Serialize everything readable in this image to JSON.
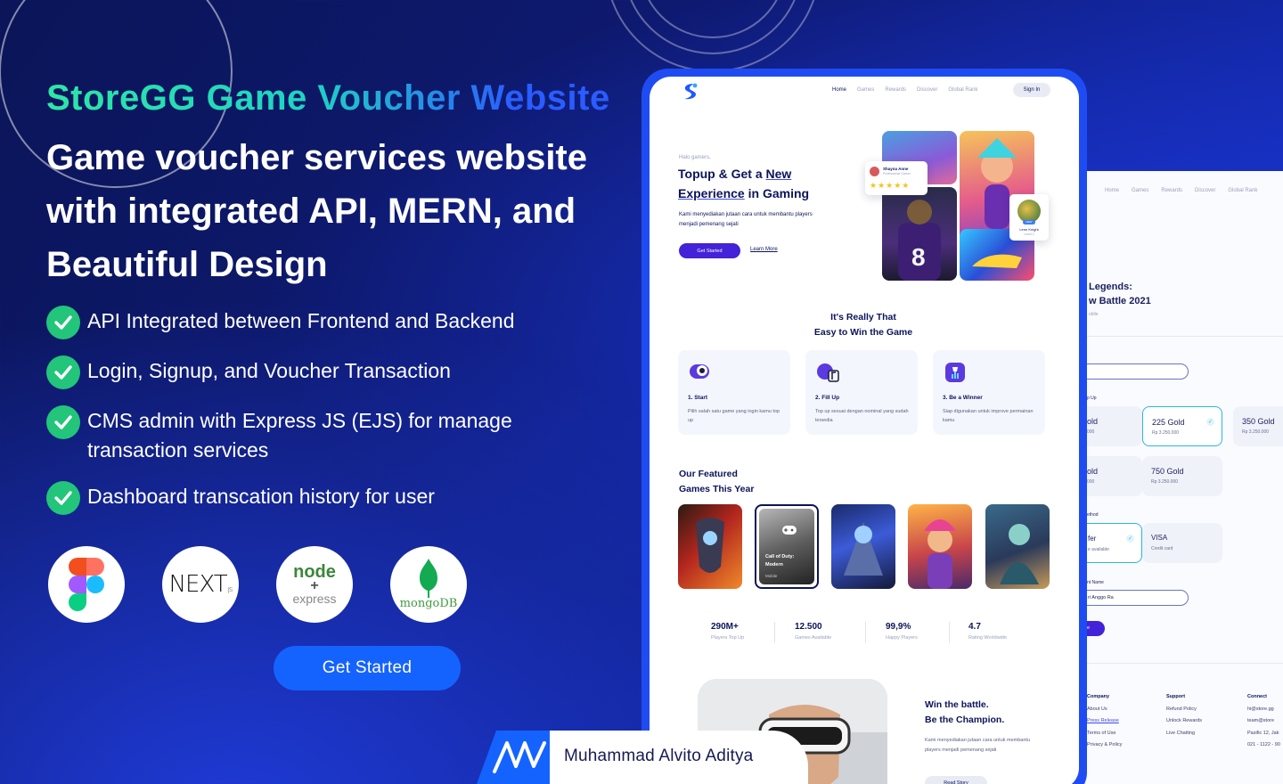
{
  "hero": {
    "title": "StoreGG Game Voucher Website",
    "headline": "Game voucher services website with integrated API, MERN, and Beautiful Design",
    "features": [
      "API Integrated between Frontend and Backend",
      "Login, Signup, and Voucher Transaction",
      "CMS admin with Express JS (EJS) for manage transaction services",
      "Dashboard transcation history for user"
    ],
    "tech_logos": [
      "figma-logo",
      "nextjs-logo",
      "node-express-logo",
      "mongodb-logo"
    ],
    "logo_text": {
      "next": "NEXT",
      "next_sub": ".JS",
      "node": "node",
      "express": "express",
      "mongo": "mongoDB"
    },
    "cta": "Get Started"
  },
  "author": {
    "name": "Muhammad Alvito Aditya"
  },
  "mockup": {
    "nav": [
      "Home",
      "Games",
      "Rewards",
      "Discover",
      "Global Rank"
    ],
    "signin": "Sign In",
    "greeting": "Halo gamers,",
    "hero_title_a": "Topup & Get a ",
    "hero_title_u1": "New",
    "hero_title_u2": "Experience",
    "hero_title_b": " in Gaming",
    "hero_desc": "Kami menyediakan jutaan cara untuk membantu players menjadi pemenang sejati",
    "get_started": "Get Started",
    "learn_more": "Learn More",
    "profile_card": {
      "name": "Shayna Anne",
      "role": "Professional Gamer",
      "stars": "★★★★★"
    },
    "player_card": {
      "name": "Lenn Knight",
      "role": "Level 2",
      "badge": "NEW"
    },
    "section1_title_a": "It's Really That",
    "section1_title_b": "Easy to Win the Game",
    "steps": [
      {
        "title": "1. Start",
        "desc": "Pilih salah satu game yang ingin kamu top up"
      },
      {
        "title": "2. Fill Up",
        "desc": "Top up sesuai dengan nominal yang sudah tersedia"
      },
      {
        "title": "3. Be a Winner",
        "desc": "Siap digunakan untuk improve permainan kamu"
      }
    ],
    "featured_title_a": "Our Featured",
    "featured_title_b": "Games This Year",
    "featured_center": {
      "name_a": "Call of Duty:",
      "name_b": "Modern",
      "platform": "Mobile"
    },
    "stats": [
      {
        "value": "290M+",
        "label": "Players Top Up"
      },
      {
        "value": "12.500",
        "label": "Games Available"
      },
      {
        "value": "99,9%",
        "label": "Happy Players"
      },
      {
        "value": "4.7",
        "label": "Rating Worldwide"
      }
    ],
    "win_title_a": "Win the battle.",
    "win_title_b": "Be the Champion.",
    "win_desc": "Kami menyediakan jutaan cara untuk membantu players menjadi pemenang sejati",
    "read_story": "Read Story"
  },
  "detail": {
    "nav": [
      "Home",
      "Games",
      "Rewards",
      "Discover",
      "Global Rank"
    ],
    "title_a": "Legends:",
    "title_b": "w Battle 2021",
    "platform": "obile",
    "topup_label": "p Up",
    "gold": [
      {
        "amount": "old",
        "price": "000",
        "bold": ""
      },
      {
        "amount": " Gold",
        "price": "Rp 3.250.000",
        "bold": "225"
      },
      {
        "amount": " Gold",
        "price": "Rp 3.250.000",
        "bold": "350"
      },
      {
        "amount": "old",
        "price": "000",
        "bold": ""
      },
      {
        "amount": " Gold",
        "price": "Rp 3.250.000",
        "bold": "750"
      }
    ],
    "payment_label": "ethod",
    "payments": [
      {
        "name": "fer",
        "sub": "e available"
      },
      {
        "name": "VISA",
        "sub": "Credit card"
      }
    ],
    "account_label": "nt Name",
    "account_value": "ri Anggo Ra",
    "continue": "e",
    "footer": {
      "company": {
        "title": "Company",
        "items": [
          "About Us",
          "Press Release",
          "Terms of Use",
          "Privacy & Policy"
        ]
      },
      "support": {
        "title": "Support",
        "items": [
          "Refund Policy",
          "Unlock Rewards",
          "Live Chatting"
        ]
      },
      "connect": {
        "title": "Connect",
        "items": [
          "hi@store.gg",
          "team@store",
          "Pasific 12, Jak",
          "021 - 1122 - 90"
        ]
      }
    }
  },
  "colors": {
    "accent": "#1463ff",
    "check": "#22c57a",
    "bg": "#0e1a72",
    "brand_blue": "#4322d8"
  }
}
